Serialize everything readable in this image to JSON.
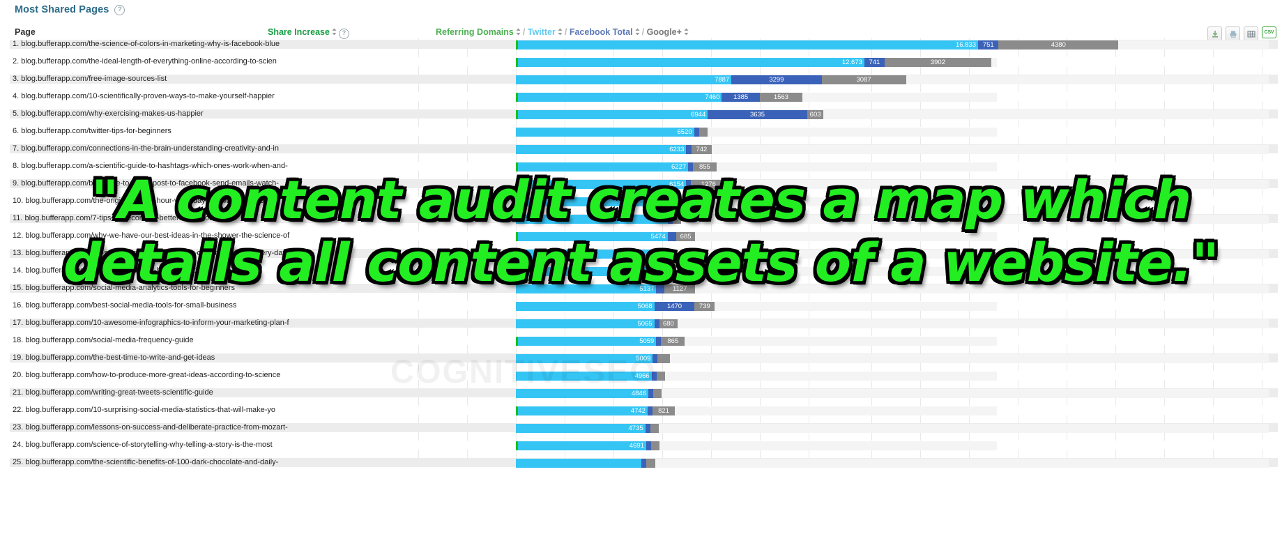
{
  "widget": {
    "title": "Most Shared Pages",
    "help_icon": "question-mark-icon"
  },
  "toolbar": {
    "download_label": "download-icon",
    "print_label": "print-icon",
    "table_label": "table-grid-icon",
    "csv_label": "CSV"
  },
  "columns": {
    "page": "Page",
    "share_increase": "Share Increase",
    "referring_domains": "Referring Domains",
    "twitter": "Twitter",
    "facebook_total": "Facebook Total",
    "google_plus": "Google+",
    "separator": "/"
  },
  "colors": {
    "title": "#2b6a88",
    "share_increase": "#179c44",
    "referring_domains": "#4caf50",
    "twitter": "#35c5f5",
    "facebook": "#3a62b8",
    "google_plus": "#8b8b8b",
    "share_marker": "#16c117"
  },
  "watermark": "COGNITIVESEO",
  "caption": {
    "line1": "\"A content audit creates a map which",
    "line2": "details all content assets of a website.\""
  },
  "chart_data": {
    "type": "bar",
    "title": "Most Shared Pages",
    "xlabel": "",
    "ylabel": "Page",
    "grid": true,
    "legend_position": "top",
    "series": [
      {
        "name": "Twitter",
        "color": "#35c5f5"
      },
      {
        "name": "Facebook Total",
        "color": "#3a62b8"
      },
      {
        "name": "Google+",
        "color": "#8b8b8b"
      }
    ],
    "categories": [
      "blog.bufferapp.com/the-science-of-colors-in-marketing-why-is-facebook-blue",
      "blog.bufferapp.com/the-ideal-length-of-everything-online-according-to-scien",
      "blog.bufferapp.com/free-image-sources-list",
      "blog.bufferapp.com/10-scientifically-proven-ways-to-make-yourself-happier",
      "blog.bufferapp.com/why-exercising-makes-us-happier",
      "blog.bufferapp.com/twitter-tips-for-beginners",
      "blog.bufferapp.com/connections-in-the-brain-understanding-creativity-and-in",
      "blog.bufferapp.com/a-scientific-guide-to-hashtags-which-ones-work-when-and-",
      "blog.bufferapp.com/best-time-to-tweet-post-to-facebook-send-emails-watch-",
      "blog.bufferapp.com/the-origin-of-the-8-hour-work-day-and-why-we-should-",
      "blog.bufferapp.com/7-tips-to-become-a-better-writer-today",
      "blog.bufferapp.com/why-we-have-our-best-ideas-in-the-shower-the-science-of",
      "blog.bufferapp.com/10-surprising-facts-about-how-our-brain-works-every-day",
      "blog.bufferapp.com/the-origin-of-the-8-hour-work-day",
      "blog.bufferapp.com/social-media-analytics-tools-for-beginners",
      "blog.bufferapp.com/best-social-media-tools-for-small-business",
      "blog.bufferapp.com/10-awesome-infographics-to-inform-your-marketing-plan-f",
      "blog.bufferapp.com/social-media-frequency-guide",
      "blog.bufferapp.com/the-best-time-to-write-and-get-ideas",
      "blog.bufferapp.com/how-to-produce-more-great-ideas-according-to-science",
      "blog.bufferapp.com/writing-great-tweets-scientific-guide",
      "blog.bufferapp.com/10-surprising-social-media-statistics-that-will-make-yo",
      "blog.bufferapp.com/lessons-on-success-and-deliberate-practice-from-mozart-",
      "blog.bufferapp.com/science-of-storytelling-why-telling-a-story-is-the-most",
      "blog.bufferapp.com/the-scientific-benefits-of-100-dark-chocolate-and-daily-"
    ],
    "rows": [
      {
        "rank": "1.",
        "page": "blog.bufferapp.com/the-science-of-colors-in-marketing-why-is-facebook-blue",
        "twitter": 16833,
        "facebook": 751,
        "googleplus": 4380,
        "share_increase": true
      },
      {
        "rank": "2.",
        "page": "blog.bufferapp.com/the-ideal-length-of-everything-online-according-to-scien",
        "twitter": 12673,
        "facebook": 741,
        "googleplus": 3902,
        "share_increase": true
      },
      {
        "rank": "3.",
        "page": "blog.bufferapp.com/free-image-sources-list",
        "twitter": 7887,
        "facebook": 3299,
        "googleplus": 3087,
        "share_increase": false
      },
      {
        "rank": "4.",
        "page": "blog.bufferapp.com/10-scientifically-proven-ways-to-make-yourself-happier",
        "twitter": 7460,
        "facebook": 1385,
        "googleplus": 1563,
        "share_increase": true
      },
      {
        "rank": "5.",
        "page": "blog.bufferapp.com/why-exercising-makes-us-happier",
        "twitter": 6944,
        "facebook": 3635,
        "googleplus": 603,
        "share_increase": true
      },
      {
        "rank": "6.",
        "page": "blog.bufferapp.com/twitter-tips-for-beginners",
        "twitter": 6520,
        "facebook": 60,
        "googleplus": 250,
        "share_increase": false
      },
      {
        "rank": "7.",
        "page": "blog.bufferapp.com/connections-in-the-brain-understanding-creativity-and-in",
        "twitter": 6233,
        "facebook": 190,
        "googleplus": 742,
        "share_increase": false
      },
      {
        "rank": "8.",
        "page": "blog.bufferapp.com/a-scientific-guide-to-hashtags-which-ones-work-when-and-",
        "twitter": 6227,
        "facebook": 150,
        "googleplus": 855,
        "share_increase": true
      },
      {
        "rank": "9.",
        "page": "blog.bufferapp.com/best-time-to-tweet-post-to-facebook-send-emails-watch-",
        "twitter": 6154,
        "facebook": 180,
        "googleplus": 1276,
        "share_increase": true
      },
      {
        "rank": "10.",
        "page": "blog.bufferapp.com/the-origin-of-the-8-hour-work-day-and-why-we-should-",
        "twitter": 5896,
        "facebook": 90,
        "googleplus": 363,
        "share_increase": false
      },
      {
        "rank": "11.",
        "page": "blog.bufferapp.com/7-tips-to-become-a-better-writer-today",
        "twitter": 5570,
        "facebook": 120,
        "googleplus": 216,
        "share_increase": false
      },
      {
        "rank": "12.",
        "page": "blog.bufferapp.com/why-we-have-our-best-ideas-in-the-shower-the-science-of",
        "twitter": 5474,
        "facebook": 320,
        "googleplus": 685,
        "share_increase": true
      },
      {
        "rank": "13.",
        "page": "blog.bufferapp.com/10-surprising-facts-about-how-our-brain-works-every-day",
        "twitter": 5362,
        "facebook": 110,
        "googleplus": 300,
        "share_increase": false
      },
      {
        "rank": "14.",
        "page": "blog.bufferapp.com/the-origin-of-the-8-hour-work-day",
        "twitter": 5210,
        "facebook": 260,
        "googleplus": 400,
        "share_increase": false
      },
      {
        "rank": "15.",
        "page": "blog.bufferapp.com/social-media-analytics-tools-for-beginners",
        "twitter": 5137,
        "facebook": 300,
        "googleplus": 1127,
        "share_increase": false
      },
      {
        "rank": "16.",
        "page": "blog.bufferapp.com/best-social-media-tools-for-small-business",
        "twitter": 5068,
        "facebook": 1470,
        "googleplus": 739,
        "share_increase": false
      },
      {
        "rank": "17.",
        "page": "blog.bufferapp.com/10-awesome-infographics-to-inform-your-marketing-plan-f",
        "twitter": 5065,
        "facebook": 60,
        "googleplus": 680,
        "share_increase": false
      },
      {
        "rank": "18.",
        "page": "blog.bufferapp.com/social-media-frequency-guide",
        "twitter": 5059,
        "facebook": 170,
        "googleplus": 865,
        "share_increase": true
      },
      {
        "rank": "19.",
        "page": "blog.bufferapp.com/the-best-time-to-write-and-get-ideas",
        "twitter": 5009,
        "facebook": 100,
        "googleplus": 460,
        "share_increase": false
      },
      {
        "rank": "20.",
        "page": "blog.bufferapp.com/how-to-produce-more-great-ideas-according-to-science",
        "twitter": 4966,
        "facebook": 70,
        "googleplus": 220,
        "share_increase": false
      },
      {
        "rank": "21.",
        "page": "blog.bufferapp.com/writing-great-tweets-scientific-guide",
        "twitter": 4846,
        "facebook": 40,
        "googleplus": 260,
        "share_increase": false
      },
      {
        "rank": "22.",
        "page": "blog.bufferapp.com/10-surprising-social-media-statistics-that-will-make-yo",
        "twitter": 4742,
        "facebook": 90,
        "googleplus": 821,
        "share_increase": true
      },
      {
        "rank": "23.",
        "page": "blog.bufferapp.com/lessons-on-success-and-deliberate-practice-from-mozart-",
        "twitter": 4735,
        "facebook": 120,
        "googleplus": 190,
        "share_increase": false
      },
      {
        "rank": "24.",
        "page": "blog.bufferapp.com/science-of-storytelling-why-telling-a-story-is-the-most",
        "twitter": 4691,
        "facebook": 130,
        "googleplus": 230,
        "share_increase": true
      },
      {
        "rank": "25.",
        "page": "blog.bufferapp.com/the-scientific-benefits-of-100-dark-chocolate-and-daily-",
        "twitter": 4600,
        "facebook": 150,
        "googleplus": 330,
        "share_increase": false
      }
    ],
    "labeled_values": {
      "1": {
        "twitter": "16.833",
        "facebook": "751",
        "googleplus": "4380"
      },
      "2": {
        "twitter": "12.673",
        "facebook": "741",
        "googleplus": "3902"
      },
      "3": {
        "twitter": "7887",
        "facebook": "3299",
        "googleplus": "3087"
      },
      "4": {
        "twitter": "7460",
        "facebook": "1385",
        "googleplus": "1563"
      },
      "5": {
        "twitter": "6944",
        "facebook": "3635",
        "googleplus": "603"
      },
      "6": {
        "twitter": "6520",
        "facebook": "",
        "googleplus": ""
      },
      "7": {
        "twitter": "6233",
        "facebook": "",
        "googleplus": "742"
      },
      "8": {
        "twitter": "6227",
        "facebook": "",
        "googleplus": "855"
      },
      "9": {
        "twitter": "6154",
        "facebook": "",
        "googleplus": "1276"
      },
      "12": {
        "twitter": "5474",
        "facebook": "",
        "googleplus": "685"
      },
      "15": {
        "twitter": "5137",
        "facebook": "",
        "googleplus": "1127"
      },
      "16": {
        "twitter": "5068",
        "facebook": "1470",
        "googleplus": "739"
      },
      "17": {
        "twitter": "5065",
        "facebook": "",
        "googleplus": "680"
      },
      "18": {
        "twitter": "5059",
        "facebook": "",
        "googleplus": "865"
      },
      "19": {
        "twitter": "5009",
        "facebook": "",
        "googleplus": ""
      },
      "20": {
        "twitter": "4966",
        "facebook": "",
        "googleplus": ""
      },
      "21": {
        "twitter": "4846",
        "facebook": "",
        "googleplus": ""
      },
      "22": {
        "twitter": "4742",
        "facebook": "",
        "googleplus": "821"
      },
      "23": {
        "twitter": "4735",
        "facebook": "",
        "googleplus": ""
      },
      "24": {
        "twitter": "4691",
        "facebook": "",
        "googleplus": ""
      }
    }
  }
}
